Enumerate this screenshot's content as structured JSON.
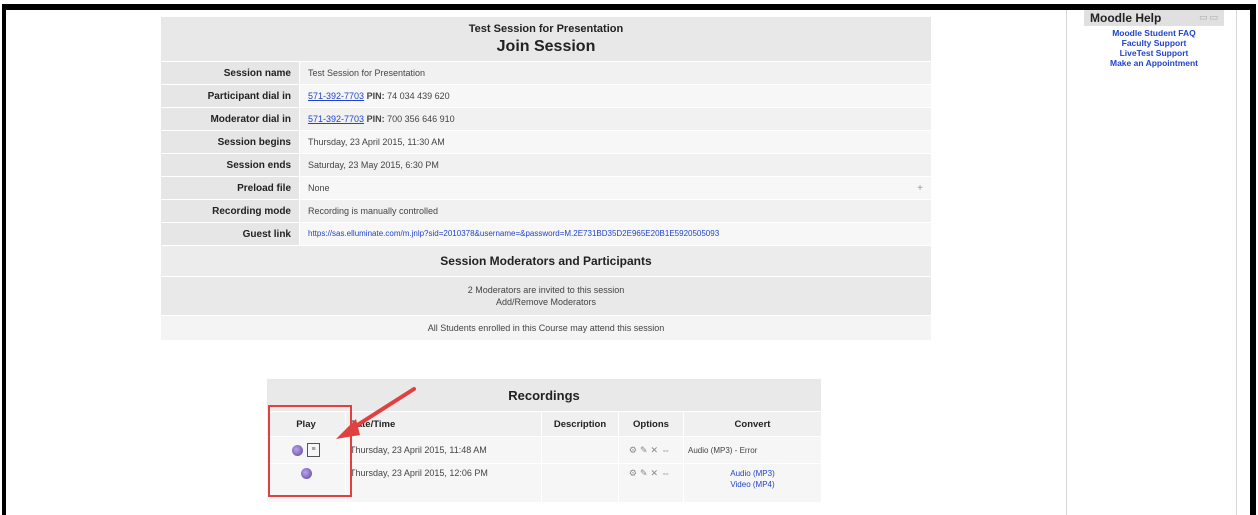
{
  "header": {
    "title": "Test Session for Presentation",
    "subtitle": "Join Session"
  },
  "details": [
    {
      "label": "Session name",
      "value": "Test Session for Presentation"
    },
    {
      "label": "Participant dial in",
      "phone": "571-392-7703",
      "pin_label": "PIN:",
      "pin": "74 034 439 620"
    },
    {
      "label": "Moderator dial in",
      "phone": "571-392-7703",
      "pin_label": "PIN:",
      "pin": "700 356 646 910"
    },
    {
      "label": "Session begins",
      "value": "Thursday, 23 April 2015, 11:30 AM"
    },
    {
      "label": "Session ends",
      "value": "Saturday, 23 May 2015, 6:30 PM"
    },
    {
      "label": "Preload file",
      "value": "None",
      "action": "+"
    },
    {
      "label": "Recording mode",
      "value": "Recording is manually controlled"
    },
    {
      "label": "Guest link",
      "value": "https://sas.elluminate.com/m.jnlp?sid=2010378&username=&password=M.2E731BD35D2E965E20B1E5920505093"
    }
  ],
  "participants": {
    "title": "Session Moderators and Participants",
    "moderators_text": "2 Moderators are invited to this session",
    "add_remove": "Add/Remove Moderators",
    "students_text": "All Students enrolled in this Course may attend this session"
  },
  "recordings": {
    "title": "Recordings",
    "columns": [
      "Play",
      "Date/Time",
      "Description",
      "Options",
      "Convert"
    ],
    "rows": [
      {
        "date": "Thursday, 23 April 2015, 11:48 AM",
        "convert": "Audio (MP3) - Error"
      },
      {
        "date": "Thursday, 23 April 2015, 12:06 PM",
        "convert_audio": "Audio (MP3)",
        "convert_video": "Video (MP4)"
      }
    ]
  },
  "help": {
    "title": "Moodle Help",
    "links": [
      "Moodle Student FAQ",
      "Faculty Support",
      "LiveTest Support",
      "Make an Appointment"
    ]
  },
  "colors": {
    "link": "#2244cc",
    "highlight": "#e04040"
  }
}
